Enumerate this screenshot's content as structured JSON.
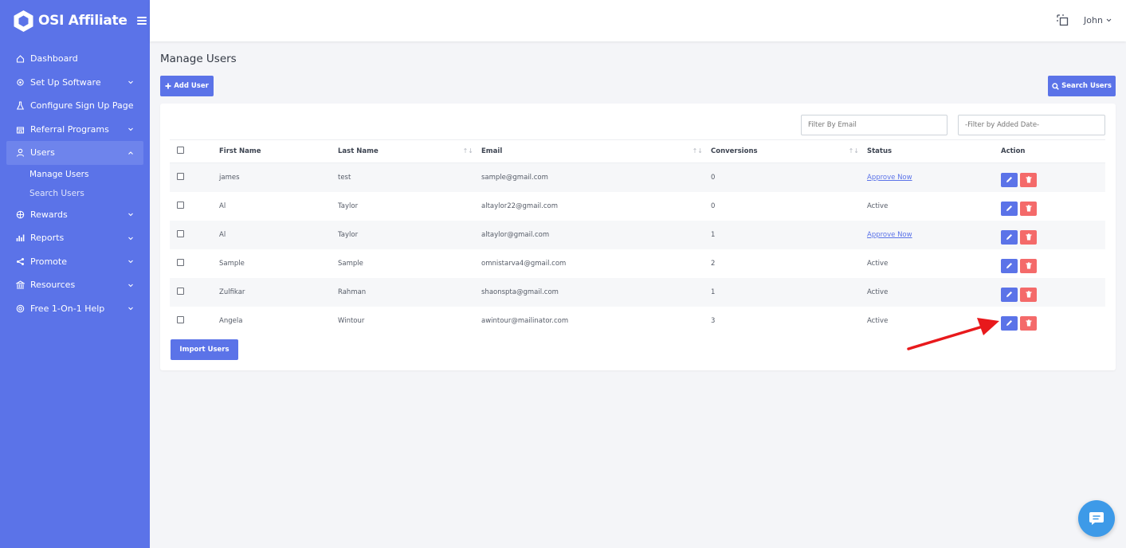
{
  "brand": {
    "name": "OSI Affiliate"
  },
  "colors": {
    "sidebar": "#5b73e8",
    "primary": "#5b73e8",
    "danger": "#f46a6a",
    "chat": "#3d9ae8",
    "arrow": "#e8191c"
  },
  "sidebar": {
    "items": [
      {
        "label": "Dashboard",
        "icon": "home-icon",
        "has_chevron": false
      },
      {
        "label": "Set Up Software",
        "icon": "gear-icon",
        "has_chevron": true
      },
      {
        "label": "Configure Sign Up Page",
        "icon": "flask-icon",
        "has_chevron": false
      },
      {
        "label": "Referral Programs",
        "icon": "store-icon",
        "has_chevron": true
      },
      {
        "label": "Users",
        "icon": "user-icon",
        "has_chevron": true,
        "active": true
      },
      {
        "label": "Rewards",
        "icon": "globe-icon",
        "has_chevron": true
      },
      {
        "label": "Reports",
        "icon": "bar-chart-icon",
        "has_chevron": true
      },
      {
        "label": "Promote",
        "icon": "share-icon",
        "has_chevron": true
      },
      {
        "label": "Resources",
        "icon": "bank-icon",
        "has_chevron": true
      },
      {
        "label": "Free 1-On-1 Help",
        "icon": "lifebuoy-icon",
        "has_chevron": true
      }
    ],
    "subitems": [
      {
        "label": "Manage Users",
        "current": true
      },
      {
        "label": "Search Users",
        "current": false
      }
    ]
  },
  "topbar": {
    "user_name": "John"
  },
  "main": {
    "title": "Manage Users",
    "add_user_label": "Add User",
    "search_users_label": "Search Users",
    "import_users_label": "Import Users",
    "filter_email_placeholder": "Filter By Email",
    "filter_date_placeholder": "-Filter by Added Date-"
  },
  "table": {
    "headers": {
      "first_name": "First Name",
      "last_name": "Last Name",
      "email": "Email",
      "conversions": "Conversions",
      "status": "Status",
      "action": "Action"
    },
    "rows": [
      {
        "first": "james",
        "last": "test",
        "email": "sample@gmail.com",
        "conversions": "0",
        "status": "Approve Now",
        "status_link": true
      },
      {
        "first": "Al",
        "last": "Taylor",
        "email": "altaylor22@gmail.com",
        "conversions": "0",
        "status": "Active",
        "status_link": false
      },
      {
        "first": "Al",
        "last": "Taylor",
        "email": "altaylor@gmail.com",
        "conversions": "1",
        "status": "Approve Now",
        "status_link": true
      },
      {
        "first": "Sample",
        "last": "Sample",
        "email": "omnistarva4@gmail.com",
        "conversions": "2",
        "status": "Active",
        "status_link": false
      },
      {
        "first": "Zulfikar",
        "last": "Rahman",
        "email": "shaonspta@gmail.com",
        "conversions": "1",
        "status": "Active",
        "status_link": false
      },
      {
        "first": "Angela",
        "last": "Wintour",
        "email": "awintour@mailinator.com",
        "conversions": "3",
        "status": "Active",
        "status_link": false
      }
    ]
  }
}
